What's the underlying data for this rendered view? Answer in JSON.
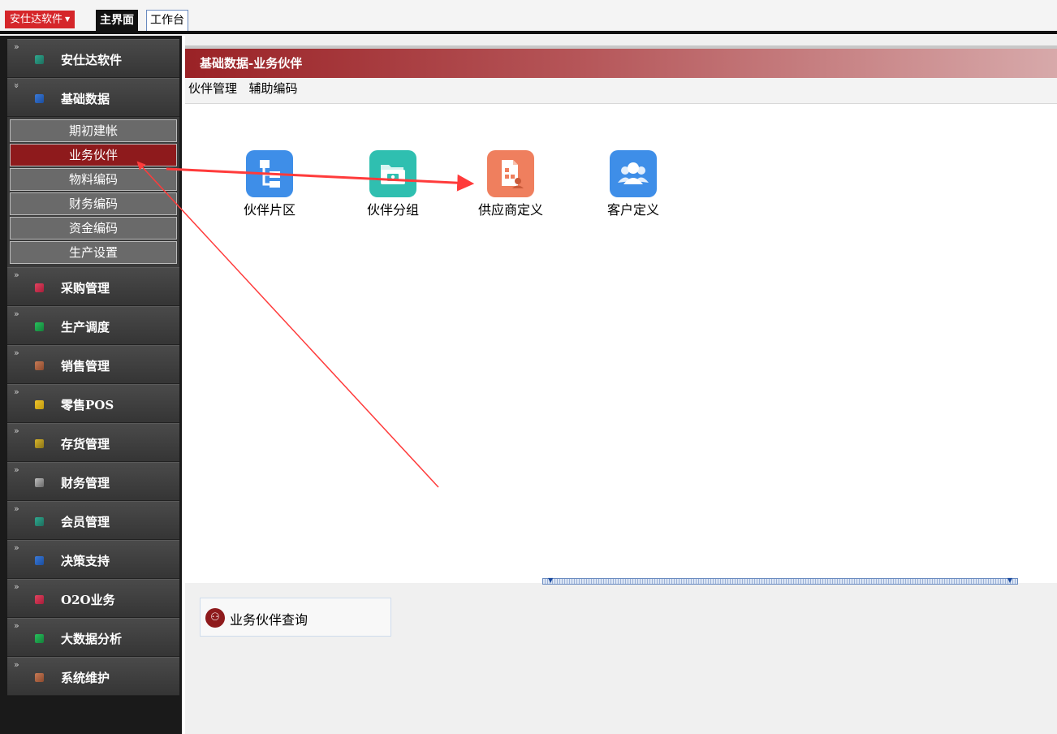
{
  "topbar": {
    "brand_label": "安仕达软件",
    "tabs": [
      {
        "label": "主界面"
      },
      {
        "label": "工作台"
      }
    ]
  },
  "sidebar": {
    "items": [
      {
        "label": "安仕达软件",
        "color": "#2fa98f"
      },
      {
        "label": "基础数据",
        "color": "#3a7ad8",
        "expanded": true
      },
      {
        "label": "采购管理",
        "color": "#e2435f"
      },
      {
        "label": "生产调度",
        "color": "#27c05c"
      },
      {
        "label": "销售管理",
        "color": "#c77a55"
      },
      {
        "label": "零售POS",
        "color": "#f0c42a"
      },
      {
        "label": "存货管理",
        "color": "#d8b42a"
      },
      {
        "label": "财务管理",
        "color": "#8c8c8c"
      },
      {
        "label": "会员管理",
        "color": "#2fa98f"
      },
      {
        "label": "决策支持",
        "color": "#3a7ad8"
      },
      {
        "label": "O2O业务",
        "color": "#e2435f"
      },
      {
        "label": "大数据分析",
        "color": "#27c05c"
      },
      {
        "label": "系统维护",
        "color": "#c77a55"
      }
    ],
    "subitems": [
      {
        "label": "期初建帐"
      },
      {
        "label": "业务伙伴",
        "active": true
      },
      {
        "label": "物料编码"
      },
      {
        "label": "财务编码"
      },
      {
        "label": "资金编码"
      },
      {
        "label": "生产设置"
      }
    ]
  },
  "content": {
    "title": "基础数据-业务伙伴",
    "menu": [
      "伙伴管理",
      "辅助编码"
    ],
    "apps": [
      {
        "label": "伙伴片区",
        "icon": "hierarchy-icon",
        "color": "#3e8ee8"
      },
      {
        "label": "伙伴分组",
        "icon": "folder-icon",
        "color": "#2fbfb0"
      },
      {
        "label": "供应商定义",
        "icon": "supplier-icon",
        "color": "#ef7f5e"
      },
      {
        "label": "客户定义",
        "icon": "customers-icon",
        "color": "#3e8ee8"
      }
    ],
    "query_label": "业务伙伴查询"
  },
  "colors": {
    "accent_red": "#8e1a1c",
    "annotation_arrow": "#ff3b3b"
  }
}
